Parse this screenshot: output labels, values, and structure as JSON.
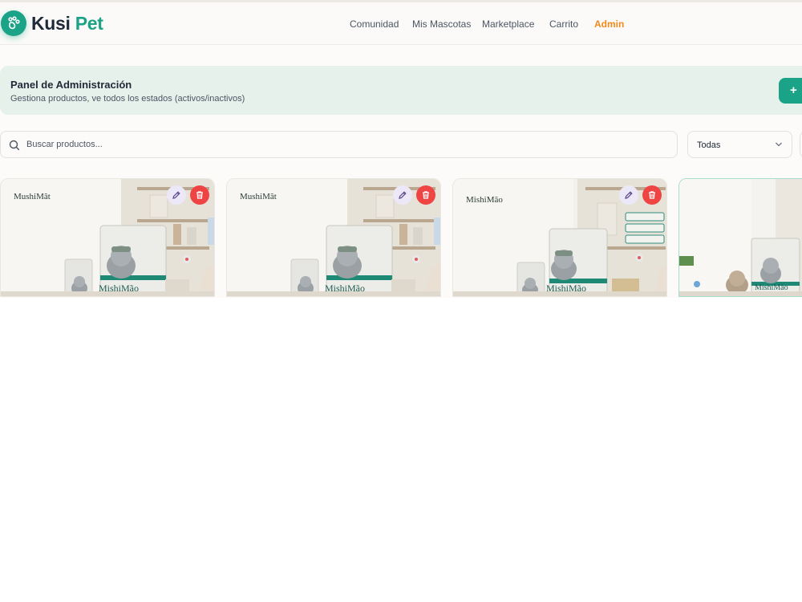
{
  "header": {
    "logo": {
      "part1": "Kusi",
      "part2": "Pet"
    },
    "nav": [
      {
        "label": "Comunidad"
      },
      {
        "label": "Mis Mascotas"
      },
      {
        "label": "Marketplace"
      },
      {
        "label": "Carrito"
      },
      {
        "label": "Admin",
        "active": true
      }
    ]
  },
  "admin_panel": {
    "title": "Panel de Administración",
    "subtitle": "Gestiona productos, ve todos los estados (activos/inactivos)",
    "add_button": "+"
  },
  "search": {
    "placeholder": "Buscar productos..."
  },
  "filter": {
    "selected": "Todas"
  },
  "products": [
    {
      "brand_a": "Mushi",
      "brand_b": "Mât",
      "bag": "MishiMão"
    },
    {
      "brand_a": "Mushi",
      "brand_b": "Mât",
      "bag": "MishiMão"
    },
    {
      "brand_a": "Mishi",
      "brand_b": "Mão",
      "bag": "MishiMão"
    },
    {
      "brand_a": "",
      "brand_b": "",
      "bag": "MishiMão"
    }
  ],
  "icons": {
    "logo": "paw-icon",
    "search": "search-icon",
    "chevron": "chevron-down-icon",
    "edit": "pencil-icon",
    "delete": "trash-icon"
  },
  "colors": {
    "brand": "#1aa386",
    "admin_nav": "#f08a1c",
    "delete": "#ef4444",
    "panel_bg": "#e6f1ec"
  }
}
